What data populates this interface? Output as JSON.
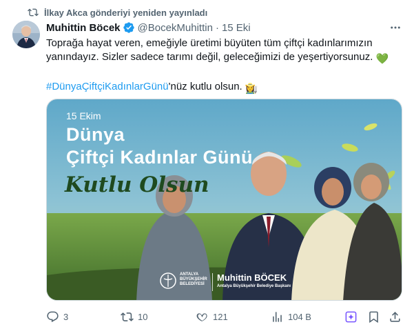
{
  "repost": {
    "text": "İlkay Akca gönderiyi yeniden yayınladı",
    "icon": "repost-icon"
  },
  "author": {
    "name": "Muhittin Böcek",
    "handle": "@BocekMuhittin",
    "separator": "·",
    "date": "15 Eki",
    "verified": true
  },
  "tweet": {
    "line1": "Toprağa hayat veren, emeğiyle üretimi büyüten tüm çiftçi kadınlarımızın yanındayız. Sizler sadece tarımı değil, geleceğimizi de yeşertiyorsunuz.",
    "emoji1": "💚",
    "hashtag": "#DünyaÇiftçiKadınlarGünü",
    "line2_rest": "'nüz kutlu olsun.",
    "emoji2": "👩‍🌾"
  },
  "media": {
    "date": "15 Ekim",
    "title_line1": "Dünya",
    "title_line2": "Çiftçi Kadınlar Günü",
    "greeting": "Kutlu Olsun",
    "logo_lines": [
      "ANTALYA",
      "BÜYÜKŞEHİR",
      "BELEDİYESİ"
    ],
    "name": "Muhittin BÖCEK",
    "role": "Antalya Büyükşehir Belediye Başkanı"
  },
  "actions": {
    "replies": "3",
    "reposts": "10",
    "likes": "121",
    "views": "104 B"
  },
  "colors": {
    "accent": "#1d9bf0",
    "repost_active": "#00ba7c",
    "muted": "#536471",
    "grok": "#7856ff"
  }
}
